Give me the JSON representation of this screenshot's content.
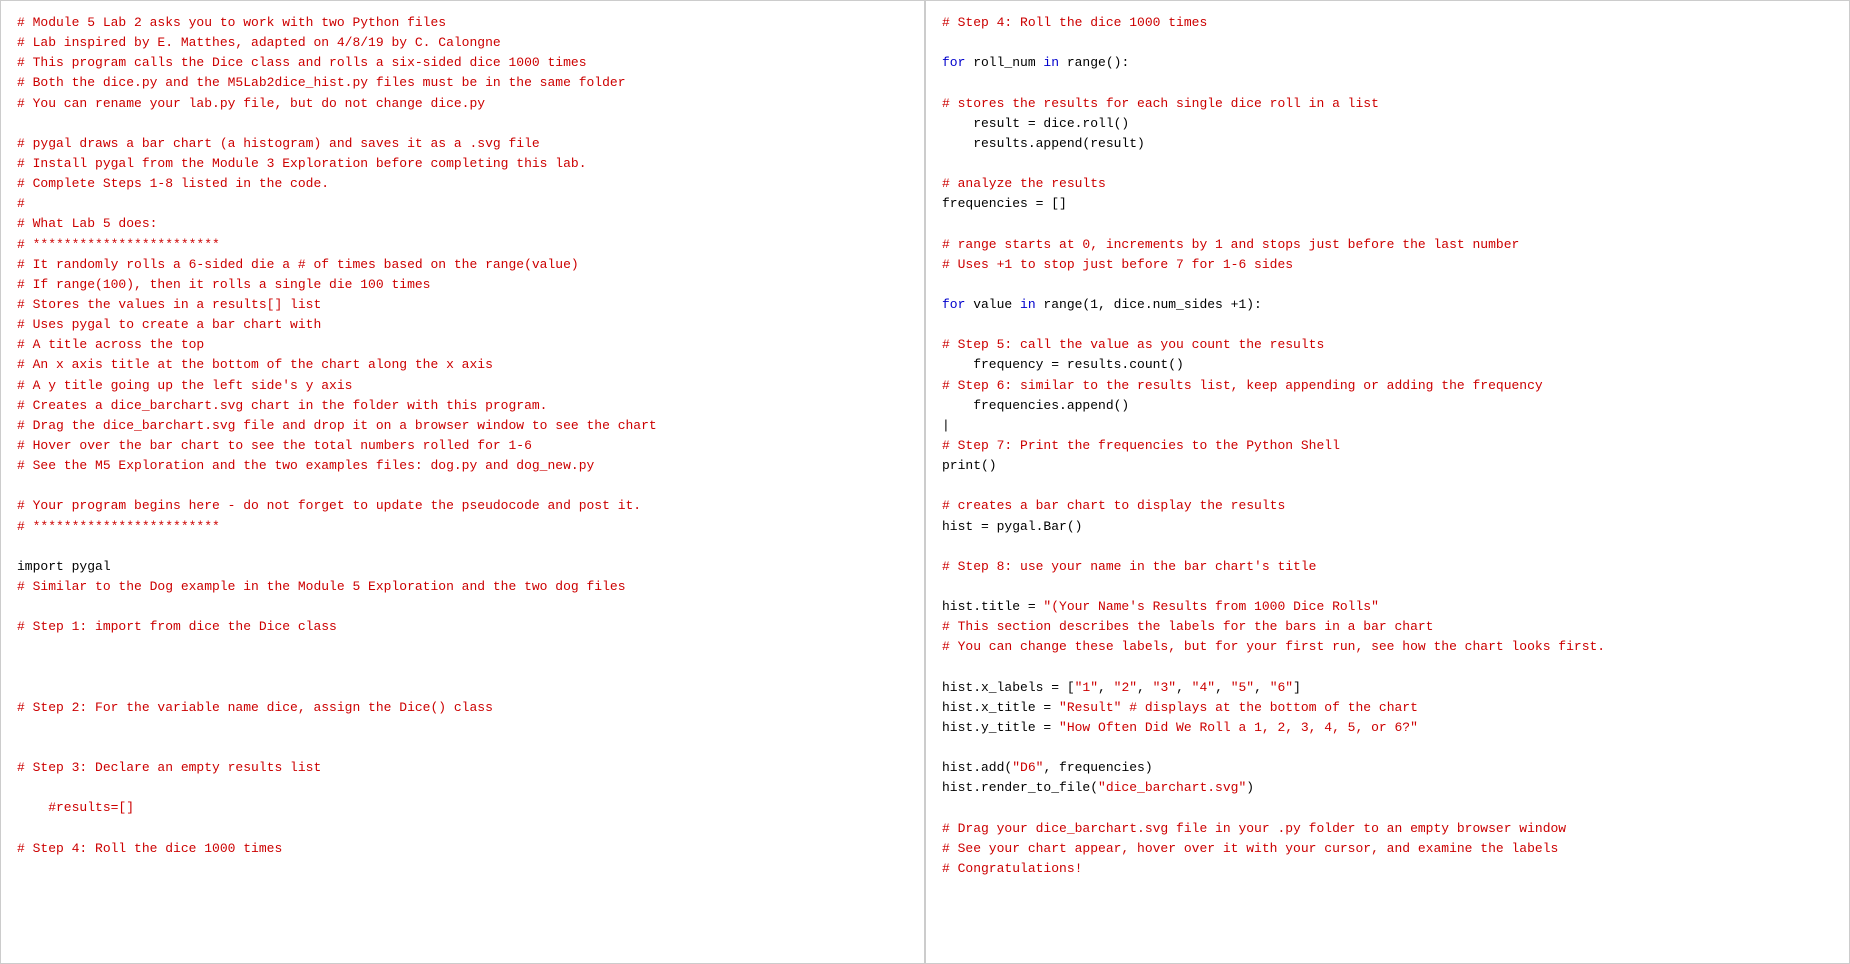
{
  "left_panel": {
    "lines": [
      {
        "text": "# Module 5 Lab 2 asks you to work with two Python files",
        "type": "comment"
      },
      {
        "text": "# Lab inspired by E. Matthes, adapted on 4/8/19 by C. Calongne",
        "type": "comment"
      },
      {
        "text": "# This program calls the Dice class and rolls a six-sided dice 1000 times",
        "type": "comment"
      },
      {
        "text": "# Both the dice.py and the M5Lab2dice_hist.py files must be in the same folder",
        "type": "comment"
      },
      {
        "text": "# You can rename your lab.py file, but do not change dice.py",
        "type": "comment"
      },
      {
        "text": "",
        "type": "empty"
      },
      {
        "text": "# pygal draws a bar chart (a histogram) and saves it as a .svg file",
        "type": "comment"
      },
      {
        "text": "# Install pygal from the Module 3 Exploration before completing this lab.",
        "type": "comment"
      },
      {
        "text": "# Complete Steps 1-8 listed in the code.",
        "type": "comment"
      },
      {
        "text": "#",
        "type": "comment"
      },
      {
        "text": "# What Lab 5 does:",
        "type": "comment"
      },
      {
        "text": "# ************************",
        "type": "comment"
      },
      {
        "text": "# It randomly rolls a 6-sided die a # of times based on the range(value)",
        "type": "comment"
      },
      {
        "text": "# If range(100), then it rolls a single die 100 times",
        "type": "comment"
      },
      {
        "text": "# Stores the values in a results[] list",
        "type": "comment"
      },
      {
        "text": "# Uses pygal to create a bar chart with",
        "type": "comment"
      },
      {
        "text": "# A title across the top",
        "type": "comment"
      },
      {
        "text": "# An x axis title at the bottom of the chart along the x axis",
        "type": "comment"
      },
      {
        "text": "# A y title going up the left side's y axis",
        "type": "comment"
      },
      {
        "text": "# Creates a dice_barchart.svg chart in the folder with this program.",
        "type": "comment"
      },
      {
        "text": "# Drag the dice_barchart.svg file and drop it on a browser window to see the chart",
        "type": "comment"
      },
      {
        "text": "# Hover over the bar chart to see the total numbers rolled for 1-6",
        "type": "comment"
      },
      {
        "text": "# See the M5 Exploration and the two examples files: dog.py and dog_new.py",
        "type": "comment"
      },
      {
        "text": "",
        "type": "empty"
      },
      {
        "text": "# Your program begins here - do not forget to update the pseudocode and post it.",
        "type": "comment"
      },
      {
        "text": "# ************************",
        "type": "comment"
      },
      {
        "text": "",
        "type": "empty"
      },
      {
        "text": "import pygal",
        "type": "mixed_import"
      },
      {
        "text": "# Similar to the Dog example in the Module 5 Exploration and the two dog files",
        "type": "comment"
      },
      {
        "text": "",
        "type": "empty"
      },
      {
        "text": "# Step 1: import from dice the Dice class",
        "type": "comment"
      },
      {
        "text": "",
        "type": "empty"
      },
      {
        "text": "",
        "type": "empty"
      },
      {
        "text": "",
        "type": "empty"
      },
      {
        "text": "# Step 2: For the variable name dice, assign the Dice() class",
        "type": "comment"
      },
      {
        "text": "",
        "type": "empty"
      },
      {
        "text": "",
        "type": "empty"
      },
      {
        "text": "# Step 3: Declare an empty results list",
        "type": "comment"
      },
      {
        "text": "",
        "type": "empty"
      },
      {
        "text": "    #results=[]",
        "type": "comment"
      },
      {
        "text": "",
        "type": "empty"
      },
      {
        "text": "# Step 4: Roll the dice 1000 times",
        "type": "comment"
      }
    ]
  },
  "right_panel": {
    "lines": [
      {
        "text": "# Step 4: Roll the dice 1000 times",
        "type": "comment"
      },
      {
        "text": "",
        "type": "empty"
      },
      {
        "text": "for roll_num in range():",
        "type": "mixed_for"
      },
      {
        "text": "",
        "type": "empty"
      },
      {
        "text": "# stores the results for each single dice roll in a list",
        "type": "comment"
      },
      {
        "text": "    result = dice.roll()",
        "type": "black"
      },
      {
        "text": "    results.append(result)",
        "type": "black"
      },
      {
        "text": "",
        "type": "empty"
      },
      {
        "text": "# analyze the results",
        "type": "comment"
      },
      {
        "text": "frequencies = []",
        "type": "black"
      },
      {
        "text": "",
        "type": "empty"
      },
      {
        "text": "# range starts at 0, increments by 1 and stops just before the last number",
        "type": "comment"
      },
      {
        "text": "# Uses +1 to stop just before 7 for 1-6 sides",
        "type": "comment"
      },
      {
        "text": "",
        "type": "empty"
      },
      {
        "text": "for value in range(1, dice.num_sides +1):",
        "type": "mixed_for2"
      },
      {
        "text": "",
        "type": "empty"
      },
      {
        "text": "# Step 5: call the value as you count the results",
        "type": "comment"
      },
      {
        "text": "    frequency = results.count()",
        "type": "black"
      },
      {
        "text": "# Step 6: similar to the results list, keep appending or adding the frequency",
        "type": "comment"
      },
      {
        "text": "    frequencies.append()",
        "type": "black"
      },
      {
        "text": "|",
        "type": "black"
      },
      {
        "text": "# Step 7: Print the frequencies to the Python Shell",
        "type": "comment"
      },
      {
        "text": "print()",
        "type": "black"
      },
      {
        "text": "",
        "type": "empty"
      },
      {
        "text": "# creates a bar chart to display the results",
        "type": "comment"
      },
      {
        "text": "hist = pygal.Bar()",
        "type": "black"
      },
      {
        "text": "",
        "type": "empty"
      },
      {
        "text": "# Step 8: use your name in the bar chart's title",
        "type": "comment"
      },
      {
        "text": "",
        "type": "empty"
      },
      {
        "text": "hist.title = \"(Your Name's Results from 1000 Dice Rolls\"",
        "type": "mixed_str"
      },
      {
        "text": "# This section describes the labels for the bars in a bar chart",
        "type": "comment"
      },
      {
        "text": "# You can change these labels, but for your first run, see how the chart looks first.",
        "type": "comment"
      },
      {
        "text": "",
        "type": "empty"
      },
      {
        "text": "hist.x_labels = [\"1\", \"2\", \"3\", \"4\", \"5\", \"6\"]",
        "type": "mixed_str2"
      },
      {
        "text": "hist.x_title = \"Result\" # displays at the bottom of the chart",
        "type": "mixed_str3"
      },
      {
        "text": "hist.y_title = \"How Often Did We Roll a 1, 2, 3, 4, 5, or 6?\"",
        "type": "mixed_str4"
      },
      {
        "text": "",
        "type": "empty"
      },
      {
        "text": "hist.add(\"D6\", frequencies)",
        "type": "mixed_str5"
      },
      {
        "text": "hist.render_to_file(\"dice_barchart.svg\")",
        "type": "mixed_str6"
      },
      {
        "text": "",
        "type": "empty"
      },
      {
        "text": "# Drag your dice_barchart.svg file in your .py folder to an empty browser window",
        "type": "comment"
      },
      {
        "text": "# See your chart appear, hover over it with your cursor, and examine the labels",
        "type": "comment"
      },
      {
        "text": "# Congratulations!",
        "type": "comment"
      }
    ]
  }
}
